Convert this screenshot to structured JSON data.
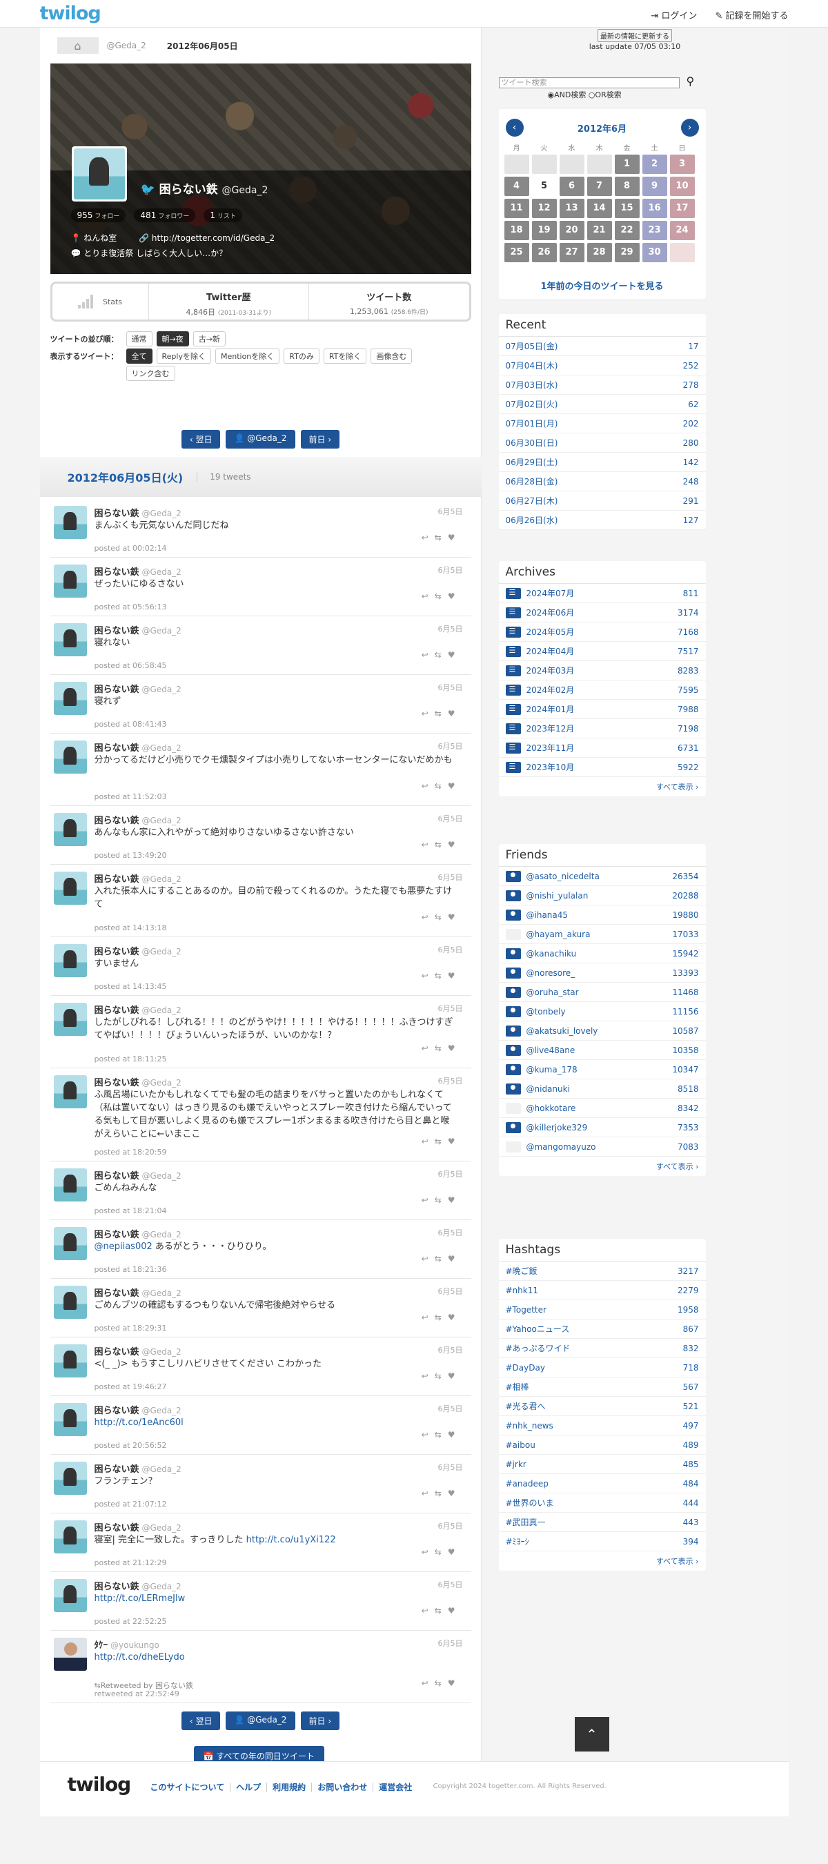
{
  "header": {
    "logo": "twilog",
    "login": "⇥ ログイン",
    "start": "✎ 記録を開始する"
  },
  "crumb": {
    "home": "⌂",
    "user": "@Geda_2",
    "date": "2012年06月05日"
  },
  "profile": {
    "name": "困らない鉄",
    "screen_name": "@Geda_2",
    "followers": "955",
    "followers_label": "フォロー",
    "following": "481",
    "following_label": "フォロワー",
    "lists": "1",
    "lists_label": "リスト",
    "location": "ねんね室",
    "url": "http://togetter.com/id/Geda_2",
    "description": "とりま復活祭 しばらく大人しい…か？"
  },
  "stats": {
    "label": "Stats",
    "history_title": "Twitter歴",
    "history_value": "4,846日",
    "history_since": "(2011-03-31より)",
    "tweets_title": "ツイート数",
    "tweets_value": "1,253,061",
    "tweets_rate": "(258.6件/日)"
  },
  "options": {
    "order_label": "ツイートの並び順：",
    "order": [
      "通常",
      "朝→夜",
      "古→新"
    ],
    "filter_label": "表示するツイート：",
    "filters": [
      "全て",
      "Replyを除く",
      "Mentionを除く",
      "RTのみ",
      "RTを除く",
      "画像含む",
      "リンク含む"
    ]
  },
  "nav": {
    "next": "‹ 翌日",
    "user": "👤 @Geda_2",
    "prev": "前日 ›"
  },
  "day": {
    "title": "2012年06月05日(火)",
    "count": "19 tweets"
  },
  "tweets": [
    {
      "name": "困らない鉄",
      "sn": "@Geda_2",
      "date": "6月5日",
      "text": "まんぶくも元気ないんだ同じだね",
      "time": "posted at 00:02:14"
    },
    {
      "name": "困らない鉄",
      "sn": "@Geda_2",
      "date": "6月5日",
      "text": "ぜったいにゆるさない",
      "time": "posted at 05:56:13"
    },
    {
      "name": "困らない鉄",
      "sn": "@Geda_2",
      "date": "6月5日",
      "text": "寝れない",
      "time": "posted at 06:58:45"
    },
    {
      "name": "困らない鉄",
      "sn": "@Geda_2",
      "date": "6月5日",
      "text": "寝れず",
      "time": "posted at 08:41:43"
    },
    {
      "name": "困らない鉄",
      "sn": "@Geda_2",
      "date": "6月5日",
      "text": "分かってるだけど小売りでクモ燻製タイプは小売りしてないホーセンターにないだめかも",
      "time": "posted at 11:52:03"
    },
    {
      "name": "困らない鉄",
      "sn": "@Geda_2",
      "date": "6月5日",
      "text": "あんなもん家に入れやがって絶対ゆりさないゆるさない許さない",
      "time": "posted at 13:49:20"
    },
    {
      "name": "困らない鉄",
      "sn": "@Geda_2",
      "date": "6月5日",
      "text": "入れた張本人にすることあるのか。目の前で殺ってくれるのか。うたた寝でも悪夢たすけて",
      "time": "posted at 14:13:18"
    },
    {
      "name": "困らない鉄",
      "sn": "@Geda_2",
      "date": "6月5日",
      "text": "すいません",
      "time": "posted at 14:13:45"
    },
    {
      "name": "困らない鉄",
      "sn": "@Geda_2",
      "date": "6月5日",
      "text": "したがしびれる！しびれる！！！のどがうやけ！！！！！やける！！！！！ふきつけすぎてやばい！！！！びょういんいったほうが、いいのかな！？",
      "time": "posted at 18:11:25"
    },
    {
      "name": "困らない鉄",
      "sn": "@Geda_2",
      "date": "6月5日",
      "text": "ふ風呂場にいたかもしれなくてでも髪の毛の詰まりをバサっと置いたのかもしれなくて（私は置いてない）はっきり見るのも嫌でえいやっとスプレー吹き付けたら縮んでいってる気もして目が悪いしよく見るのも嫌でスプレー1ポンまるまる吹き付けたら目と鼻と喉がえらいことに←いまここ",
      "time": "posted at 18:20:59"
    },
    {
      "name": "困らない鉄",
      "sn": "@Geda_2",
      "date": "6月5日",
      "text": "ごめんねみんな",
      "time": "posted at 18:21:04"
    },
    {
      "name": "困らない鉄",
      "sn": "@Geda_2",
      "date": "6月5日",
      "mention": "@nepiias002",
      "text": " あるがとう・・・ひりひり。",
      "time": "posted at 18:21:36"
    },
    {
      "name": "困らない鉄",
      "sn": "@Geda_2",
      "date": "6月5日",
      "text": "ごめんブツの確認もするつもりないんで帰宅後絶対やらせる",
      "time": "posted at 18:29:31"
    },
    {
      "name": "困らない鉄",
      "sn": "@Geda_2",
      "date": "6月5日",
      "text": "<(_ _)> もうすこしリハビリさせてください こわかった",
      "time": "posted at 19:46:27"
    },
    {
      "name": "困らない鉄",
      "sn": "@Geda_2",
      "date": "6月5日",
      "link": "http://t.co/1eAnc60l",
      "text": "",
      "time": "posted at 20:56:52"
    },
    {
      "name": "困らない鉄",
      "sn": "@Geda_2",
      "date": "6月5日",
      "text": "フランチェン？",
      "time": "posted at 21:07:12"
    },
    {
      "name": "困らない鉄",
      "sn": "@Geda_2",
      "date": "6月5日",
      "text": "寝室| 完全に一致した。すっきりした ",
      "link": "http://t.co/u1yXi122",
      "time": "posted at 21:12:29"
    },
    {
      "name": "困らない鉄",
      "sn": "@Geda_2",
      "date": "6月5日",
      "link": "http://t.co/LERmeJlw",
      "text": "",
      "time": "posted at 22:52:25"
    },
    {
      "name": "ﾀｹｰ",
      "sn": "@youkungo",
      "date": "6月5日",
      "link": "http://t.co/dheELydo",
      "text": "",
      "rt": "⇆Retweeted by 困らない鉄",
      "time": "retweeted at 22:52:49",
      "other": true
    }
  ],
  "year_button": "📅 すべての年の同日ツイート",
  "side": {
    "update_btn": "最新の情報に更新する",
    "last_update": "last update 07/05 03:10",
    "search_placeholder": "ツイート検索",
    "radio_and": "◉AND検索",
    "radio_or": "○OR検索",
    "cal_title": "2012年6月",
    "cal_prev": "‹",
    "cal_next": "›",
    "cal_dow": [
      "月",
      "火",
      "水",
      "木",
      "金",
      "土",
      "日"
    ],
    "cal_link": "1年前の今日のツイートを見る",
    "recent_title": "Recent",
    "recent": [
      {
        "l": "07月05日(金)",
        "r": "17"
      },
      {
        "l": "07月04日(木)",
        "r": "252"
      },
      {
        "l": "07月03日(水)",
        "r": "278"
      },
      {
        "l": "07月02日(火)",
        "r": "62"
      },
      {
        "l": "07月01日(月)",
        "r": "202"
      },
      {
        "l": "06月30日(日)",
        "r": "280"
      },
      {
        "l": "06月29日(土)",
        "r": "142"
      },
      {
        "l": "06月28日(金)",
        "r": "248"
      },
      {
        "l": "06月27日(木)",
        "r": "291"
      },
      {
        "l": "06月26日(水)",
        "r": "127"
      }
    ],
    "archives_title": "Archives",
    "archives": [
      {
        "l": "2024年07月",
        "r": "811"
      },
      {
        "l": "2024年06月",
        "r": "3174"
      },
      {
        "l": "2024年05月",
        "r": "7168"
      },
      {
        "l": "2024年04月",
        "r": "7517"
      },
      {
        "l": "2024年03月",
        "r": "8283"
      },
      {
        "l": "2024年02月",
        "r": "7595"
      },
      {
        "l": "2024年01月",
        "r": "7988"
      },
      {
        "l": "2023年12月",
        "r": "7198"
      },
      {
        "l": "2023年11月",
        "r": "6731"
      },
      {
        "l": "2023年10月",
        "r": "5922"
      }
    ],
    "friends_title": "Friends",
    "friends": [
      {
        "l": "@asato_nicedelta",
        "r": "26354"
      },
      {
        "l": "@nishi_yulalan",
        "r": "20288"
      },
      {
        "l": "@ihana45",
        "r": "19880"
      },
      {
        "l": "@hayam_akura",
        "r": "17033",
        "blank": true
      },
      {
        "l": "@kanachiku",
        "r": "15942"
      },
      {
        "l": "@noresore_",
        "r": "13393"
      },
      {
        "l": "@oruha_star",
        "r": "11468"
      },
      {
        "l": "@tonbely",
        "r": "11156"
      },
      {
        "l": "@akatsuki_lovely",
        "r": "10587"
      },
      {
        "l": "@live48ane",
        "r": "10358"
      },
      {
        "l": "@kuma_178",
        "r": "10347"
      },
      {
        "l": "@nidanuki",
        "r": "8518"
      },
      {
        "l": "@hokkotare",
        "r": "8342",
        "blank": true
      },
      {
        "l": "@killerjoke329",
        "r": "7353"
      },
      {
        "l": "@mangomayuzo",
        "r": "7083",
        "blank": true
      }
    ],
    "hashtags_title": "Hashtags",
    "hashtags": [
      {
        "l": "#晩ご飯",
        "r": "3217"
      },
      {
        "l": "#nhk11",
        "r": "2279"
      },
      {
        "l": "#Togetter",
        "r": "1958"
      },
      {
        "l": "#Yahooニュース",
        "r": "867"
      },
      {
        "l": "#あっぷるワイド",
        "r": "832"
      },
      {
        "l": "#DayDay",
        "r": "718"
      },
      {
        "l": "#相棒",
        "r": "567"
      },
      {
        "l": "#光る君へ",
        "r": "521"
      },
      {
        "l": "#nhk_news",
        "r": "497"
      },
      {
        "l": "#aibou",
        "r": "489"
      },
      {
        "l": "#jrkr",
        "r": "485"
      },
      {
        "l": "#anadeep",
        "r": "484"
      },
      {
        "l": "#世界のいま",
        "r": "444"
      },
      {
        "l": "#武田真一",
        "r": "443"
      },
      {
        "l": "#ﾐﾖｰｼ",
        "r": "394"
      }
    ],
    "more": "すべて表示 ›",
    "totop": "⌃"
  },
  "footer": {
    "logo": "twilog",
    "links": [
      "このサイトについて",
      "ヘルプ",
      "利用規約",
      "お問い合わせ",
      "運営会社"
    ],
    "copyright": "Copyright 2024 togetter.com. All Rights Reserved."
  }
}
